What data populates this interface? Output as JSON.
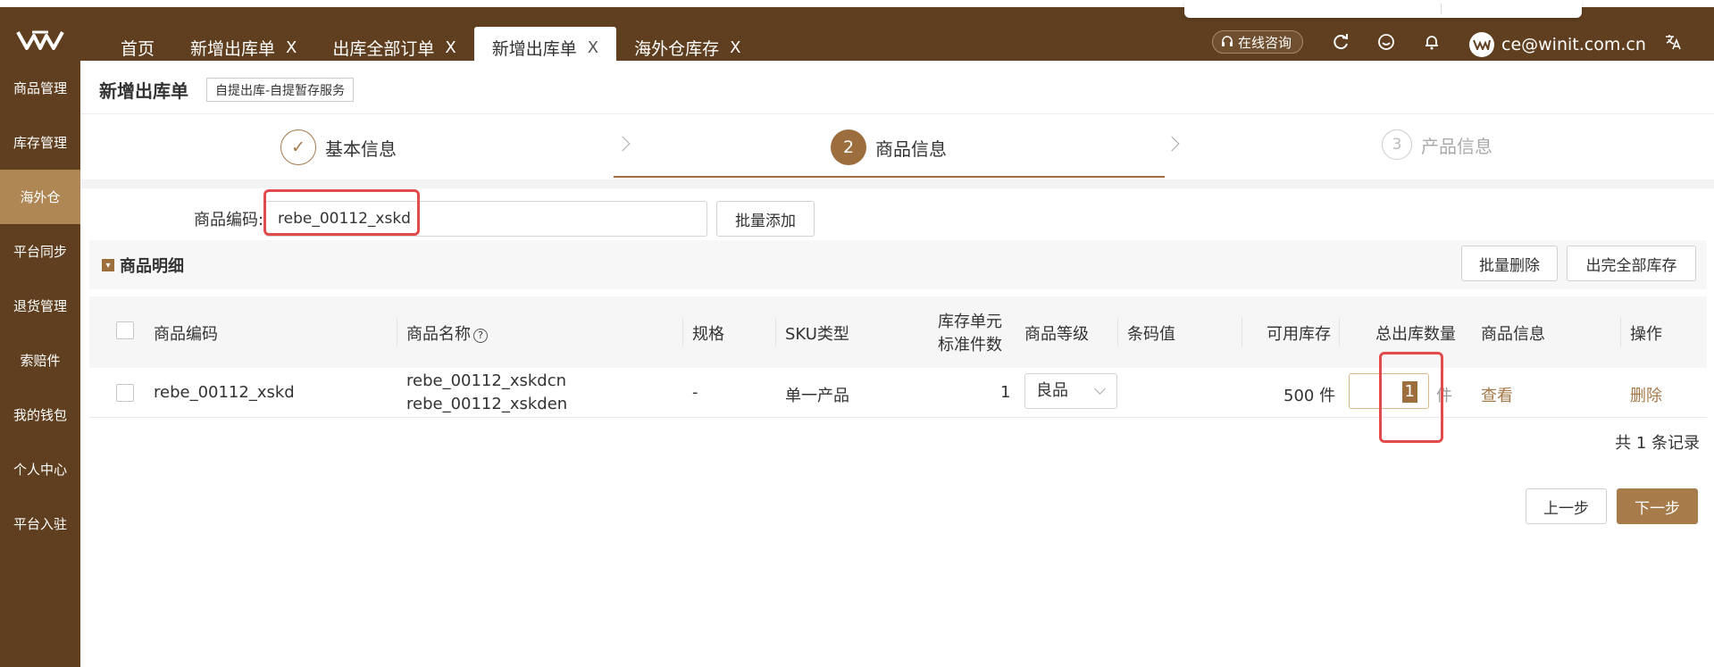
{
  "header": {
    "tabs": [
      {
        "label": "首页",
        "closable": false,
        "active": false
      },
      {
        "label": "新增出库单",
        "closable": true,
        "active": false
      },
      {
        "label": "出库全部订单",
        "closable": true,
        "active": false
      },
      {
        "label": "新增出库单",
        "closable": true,
        "active": true
      },
      {
        "label": "海外仓库存",
        "closable": true,
        "active": false
      }
    ],
    "close_glyph": "X",
    "consult_label": "在线咨询",
    "user_email": "ce@winit.com.cn",
    "icons": [
      "refresh-icon",
      "smile-icon",
      "bell-icon",
      "translate-icon"
    ]
  },
  "sidebar": {
    "items": [
      {
        "label": "商品管理",
        "active": false
      },
      {
        "label": "库存管理",
        "active": false
      },
      {
        "label": "海外仓",
        "active": true
      },
      {
        "label": "平台同步",
        "active": false
      },
      {
        "label": "退货管理",
        "active": false
      },
      {
        "label": "索赔件",
        "active": false
      },
      {
        "label": "我的钱包",
        "active": false
      },
      {
        "label": "个人中心",
        "active": false
      },
      {
        "label": "平台入驻",
        "active": false
      }
    ]
  },
  "page": {
    "title": "新增出库单",
    "tag": "自提出库-自提暂存服务"
  },
  "steps": [
    {
      "num": "✓",
      "label": "基本信息",
      "state": "done"
    },
    {
      "num": "2",
      "label": "商品信息",
      "state": "current"
    },
    {
      "num": "3",
      "label": "产品信息",
      "state": "pending"
    }
  ],
  "code_search": {
    "label": "商品编码:",
    "value": "rebe_00112_xskd",
    "batch_add_label": "批量添加"
  },
  "detail": {
    "title": "商品明细",
    "batch_delete_label": "批量删除",
    "out_all_label": "出完全部库存"
  },
  "table": {
    "headers": {
      "code": "商品编码",
      "name": "商品名称",
      "spec": "规格",
      "sku_type": "SKU类型",
      "unit_line1": "库存单元",
      "unit_line2": "标准件数",
      "grade": "商品等级",
      "barcode": "条码值",
      "available": "可用库存",
      "total_out": "总出库数量",
      "info": "商品信息",
      "action": "操作"
    },
    "rows": [
      {
        "code": "rebe_00112_xskd",
        "name_cn": "rebe_00112_xskdcn",
        "name_en": "rebe_00112_xskden",
        "spec": "-",
        "sku_type": "单一产品",
        "unit_count": "1",
        "grade": "良品",
        "barcode": "",
        "available": "500 件",
        "qty": "1",
        "qty_unit": "件",
        "view_label": "查看",
        "delete_label": "删除"
      }
    ]
  },
  "records_text": "共 1 条记录",
  "footer": {
    "prev_label": "上一步",
    "next_label": "下一步"
  },
  "colors": {
    "brand_dark": "#5f3f1f",
    "brand_accent": "#a77b4a",
    "highlight_red": "#e14b4b"
  }
}
